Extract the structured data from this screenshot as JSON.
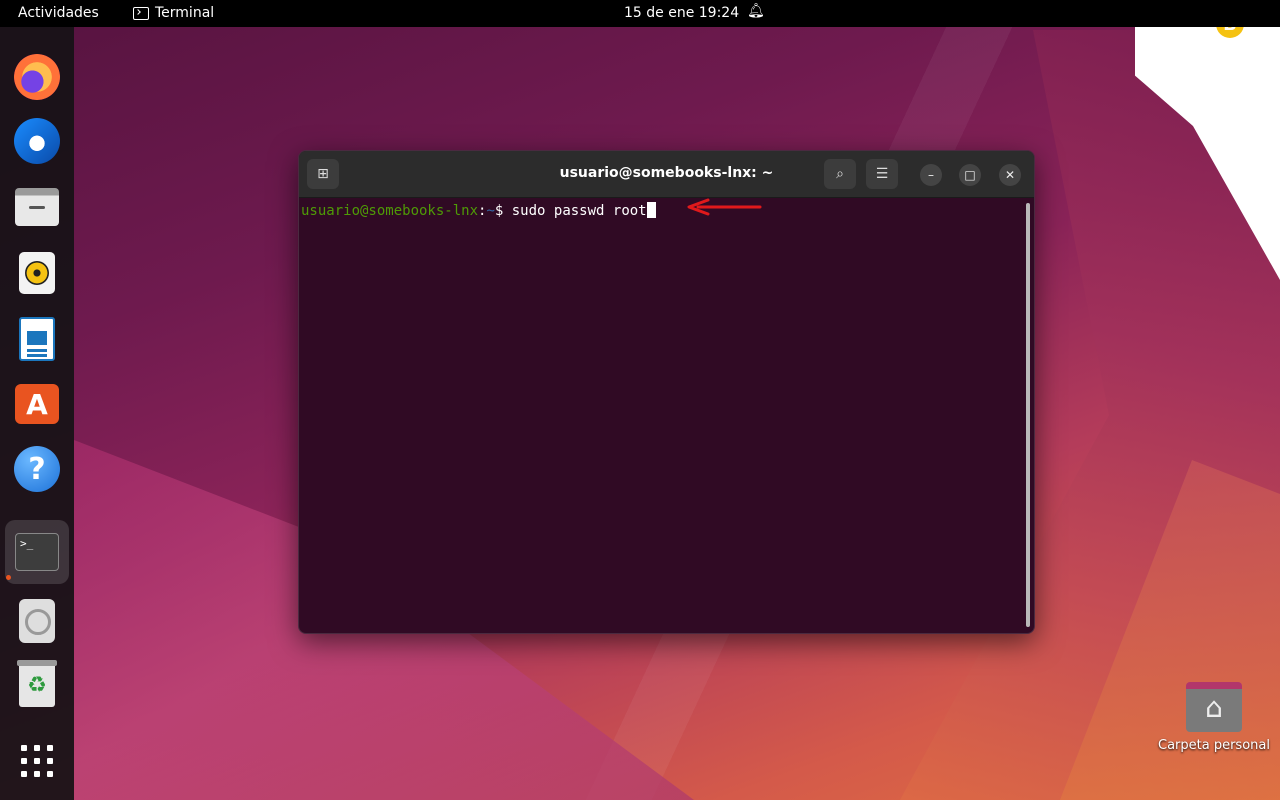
{
  "topbar": {
    "activities": "Actividades",
    "app_name": "Terminal",
    "datetime": "15 de ene  19:24"
  },
  "dock": {
    "items": [
      {
        "name": "firefox",
        "icon": "firefox-icon"
      },
      {
        "name": "thunderbird",
        "icon": "thunderbird-icon"
      },
      {
        "name": "files",
        "icon": "files-icon"
      },
      {
        "name": "rhythmbox",
        "icon": "rhythmbox-icon"
      },
      {
        "name": "libreoffice-writer",
        "icon": "writer-icon"
      },
      {
        "name": "ubuntu-software",
        "icon": "software-store-icon"
      },
      {
        "name": "help",
        "icon": "help-icon",
        "glyph": "?"
      },
      {
        "name": "terminal",
        "icon": "terminal-icon",
        "glyph": ">_",
        "active": true
      },
      {
        "name": "disc",
        "icon": "disc-icon"
      },
      {
        "name": "trash",
        "icon": "trash-icon",
        "glyph": "♻"
      },
      {
        "name": "show-apps",
        "icon": "app-grid-icon"
      }
    ]
  },
  "terminal": {
    "title": "usuario@somebooks-lnx: ~",
    "prompt_user": "usuario@somebooks-lnx",
    "prompt_sep": ":",
    "prompt_path": "~",
    "prompt_symbol": "$ ",
    "command": "sudo passwd root"
  },
  "desktop": {
    "home_folder_label": "Carpeta personal"
  },
  "colors": {
    "terminal_bg": "#300a24",
    "prompt_user": "#4e9a06",
    "prompt_path": "#3465a4",
    "dock_active_dot": "#e95420",
    "arrow": "#e0191b"
  }
}
